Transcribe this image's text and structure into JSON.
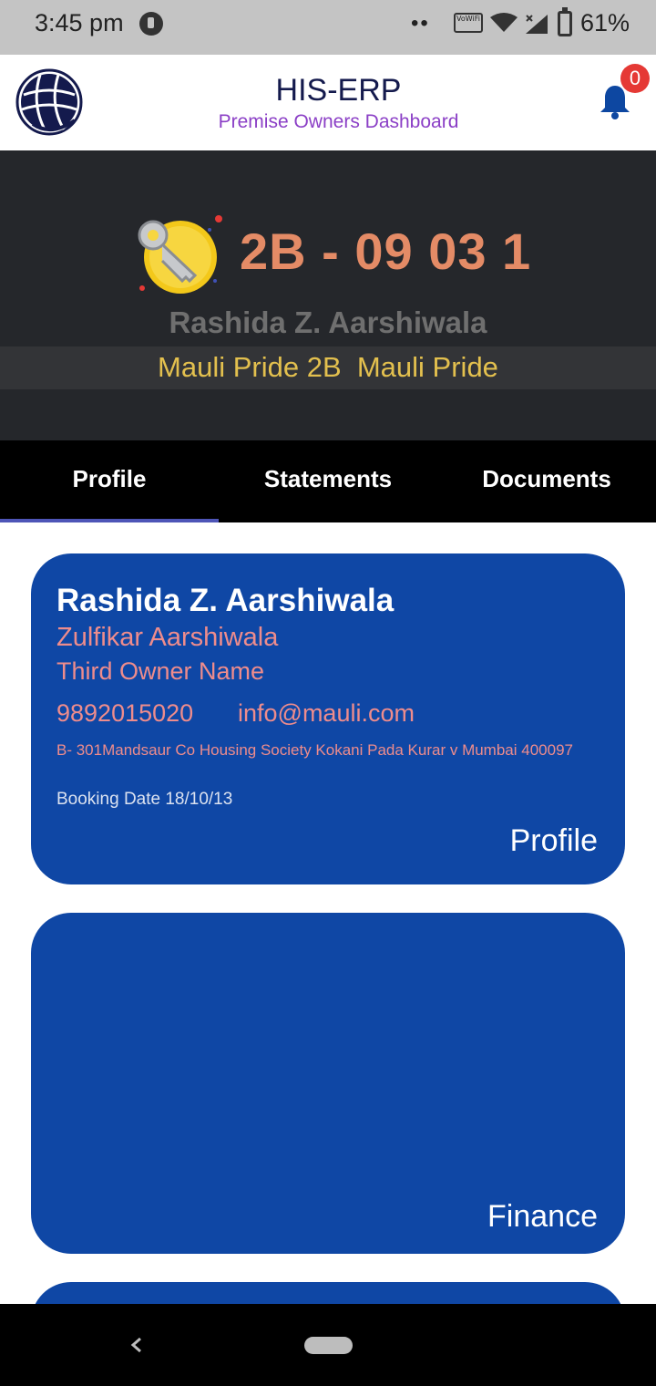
{
  "status_bar": {
    "time": "3:45 pm",
    "vowifi_label": "VoWiFi",
    "battery": "61%"
  },
  "header": {
    "title": "HIS-ERP",
    "subtitle": "Premise Owners Dashboard",
    "notification_count": "0",
    "colors": {
      "title": "#141a4d",
      "subtitle": "#8b3fc6",
      "bell": "#0d47a1",
      "badge": "#e53935"
    }
  },
  "hero": {
    "unit_code": "2B - 09 03 1",
    "owner_name": "Rashida Z. Aarshiwala",
    "project": "Mauli Pride 2B  Mauli Pride",
    "colors": {
      "background": "#25272b",
      "unit_code": "#e48b66",
      "project": "#e3c04e"
    }
  },
  "tabs": [
    {
      "label": "Profile",
      "active": true
    },
    {
      "label": "Statements",
      "active": false
    },
    {
      "label": "Documents",
      "active": false
    }
  ],
  "profile_card": {
    "primary_owner": "Rashida Z. Aarshiwala",
    "second_owner": "Zulfikar Aarshiwala",
    "third_owner": "Third Owner Name",
    "phone": "9892015020",
    "email": "info@mauli.com",
    "address": "B- 301Mandsaur Co Housing Society Kokani Pada Kurar v Mumbai 400097",
    "booking_date": "Booking Date 18/10/13",
    "label": "Profile"
  },
  "finance_card": {
    "label": "Finance"
  },
  "card_color": "#0f47a5",
  "icons": {
    "logo": "globe-logo-icon",
    "notification": "bell-icon",
    "unit": "key-coin-icon",
    "nav_back": "back-chevron-icon"
  }
}
